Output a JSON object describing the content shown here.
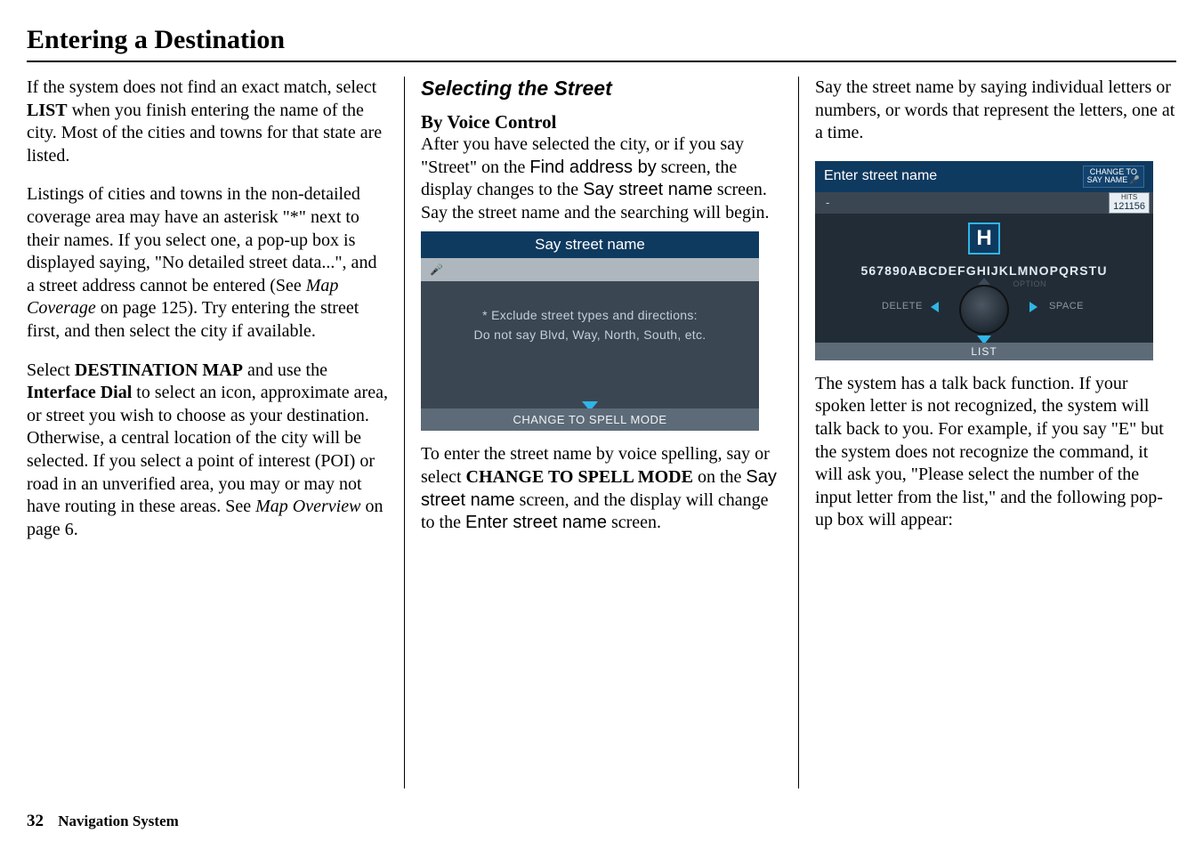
{
  "page": {
    "title": "Entering a Destination",
    "footer_section": "Navigation System",
    "page_number": "32"
  },
  "col1": {
    "p1_a": "If the system does not find an exact match, select ",
    "p1_b": "LIST",
    "p1_c": " when you finish entering the name of the city. Most of the cities and towns for that state are listed.",
    "p2_a": "Listings of cities and towns in the non-detailed coverage area may have an asterisk \"*\" next to their names. If you select one, a pop-up box is displayed saying, \"No detailed street data...\", and a street address cannot be entered (See ",
    "p2_b": "Map Coverage",
    "p2_c": " on page 125). Try entering the street first, and then select the city if available.",
    "p3_a": "Select ",
    "p3_b": "DESTINATION MAP",
    "p3_c": " and use the ",
    "p3_d": "Interface Dial",
    "p3_e": " to select an icon, approximate area, or street you wish to choose as your destination. Otherwise, a central location of the city will be selected. If you select a point of interest (POI) or road in an unverified area, you may or may not have routing in these areas. See ",
    "p3_f": "Map Overview",
    "p3_g": " on page 6."
  },
  "col2": {
    "heading": "Selecting the Street",
    "subheading": "By Voice Control",
    "p1_a": "After you have selected the city, or if you say \"Street\" on the ",
    "p1_b": "Find address by",
    "p1_c": " screen, the display changes to the ",
    "p1_d": "Say street name",
    "p1_e": " screen. Say the street name and the searching will begin.",
    "screen1": {
      "title": "Say street name",
      "body1": "* Exclude street types and directions:",
      "body2": "Do not say Blvd, Way, North, South, etc.",
      "bottom": "CHANGE TO SPELL MODE"
    },
    "p2_a": "To enter the street name by voice spelling, say or select ",
    "p2_b": "CHANGE TO SPELL MODE",
    "p2_c": " on the ",
    "p2_d": "Say street name",
    "p2_e": " screen, and the display will change to the ",
    "p2_f": "Enter street name",
    "p2_g": " screen."
  },
  "col3": {
    "p1": "Say the street name by saying individual letters or numbers, or words that represent the letters, one at a time.",
    "screen2": {
      "title": "Enter street name",
      "changeto": "CHANGE TO\nSAY NAME",
      "dash": "-",
      "hits_label": "HITS",
      "hits": "121156",
      "bigletter": "H",
      "arc": "567890ABCDEFGHIJKLMNOPQRSTU",
      "delete": "DELETE",
      "space": "SPACE",
      "option": "OPTION",
      "bottom": "LIST"
    },
    "p2": "The system has a talk back function. If your spoken letter is not recognized, the system will talk back to you. For example, if you say \"E\" but the system does not recognize the command, it will ask you, \"Please select the number of the input letter from the list,\" and the following pop-up box will appear:"
  }
}
